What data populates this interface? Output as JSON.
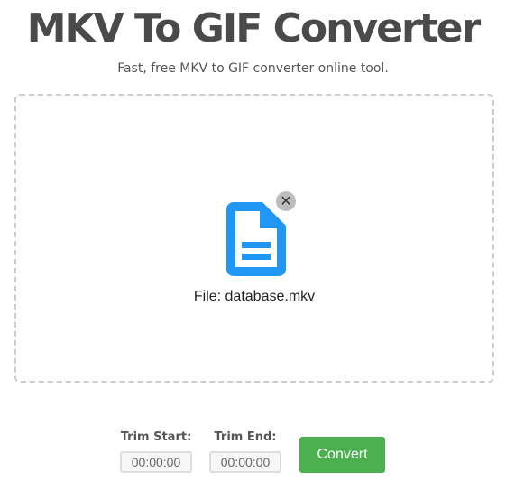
{
  "header": {
    "title": "MKV To GIF Converter",
    "subtitle": "Fast, free MKV to GIF converter online tool."
  },
  "dropzone": {
    "file_label": "File: database.mkv",
    "remove_glyph": "✕",
    "file_icon": "document-icon",
    "icon_color": "#2196f3"
  },
  "controls": {
    "trim_start_label": "Trim Start:",
    "trim_start_value": "00:00:00",
    "trim_end_label": "Trim End:",
    "trim_end_value": "00:00:00",
    "convert_label": "Convert",
    "convert_color": "#4caf50"
  }
}
